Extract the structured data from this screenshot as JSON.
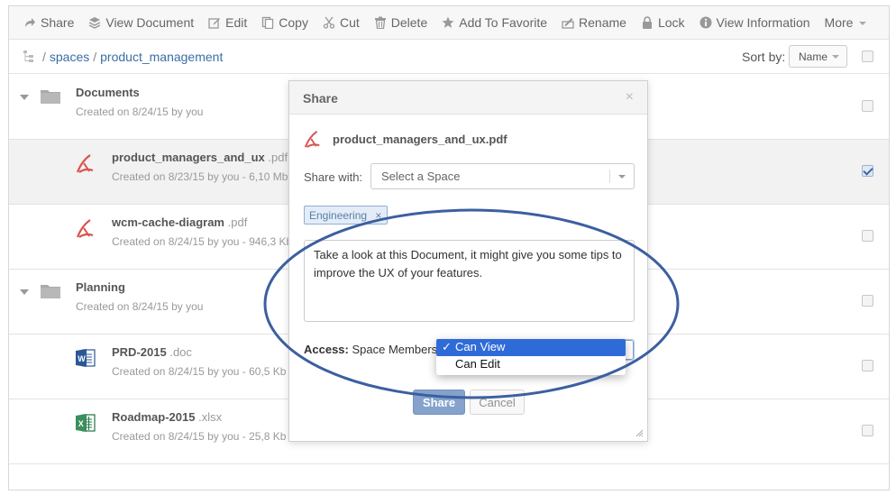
{
  "toolbar": {
    "items": [
      {
        "label": "Share",
        "icon": "share-icon"
      },
      {
        "label": "View Document",
        "icon": "layers-icon"
      },
      {
        "label": "Edit",
        "icon": "edit-icon"
      },
      {
        "label": "Copy",
        "icon": "copy-icon"
      },
      {
        "label": "Cut",
        "icon": "scissors-icon"
      },
      {
        "label": "Delete",
        "icon": "trash-icon"
      },
      {
        "label": "Add To Favorite",
        "icon": "star-icon"
      },
      {
        "label": "Rename",
        "icon": "rename-icon"
      },
      {
        "label": "Lock",
        "icon": "lock-icon"
      },
      {
        "label": "View Information",
        "icon": "info-icon"
      },
      {
        "label": "More",
        "icon": "chevron-down-icon"
      }
    ]
  },
  "breadcrumb": {
    "root_icon": "tree-icon",
    "sep": "/",
    "items": [
      "spaces",
      "product_management"
    ]
  },
  "sort": {
    "label": "Sort by:",
    "value": "Name"
  },
  "rows": [
    {
      "kind": "folder",
      "name": "Documents",
      "ext": "",
      "meta": "Created on 8/24/15 by you",
      "checked": false
    },
    {
      "kind": "pdf",
      "name": "product_managers_and_ux",
      "ext": ".pdf",
      "meta": "Created on 8/23/15 by you - 6,10 Mb",
      "checked": true
    },
    {
      "kind": "pdf",
      "name": "wcm-cache-diagram",
      "ext": ".pdf",
      "meta": "Created on 8/24/15 by you - 946,3 Kb",
      "checked": false
    },
    {
      "kind": "folder",
      "name": "Planning",
      "ext": "",
      "meta": "Created on 8/24/15 by you",
      "checked": false
    },
    {
      "kind": "word",
      "name": "PRD-2015",
      "ext": ".doc",
      "meta": "Created on 8/24/15 by you - 60,5 Kb",
      "checked": false
    },
    {
      "kind": "excel",
      "name": "Roadmap-2015",
      "ext": ".xlsx",
      "meta": "Created on 8/24/15 by you - 25,8 Kb",
      "checked": false
    }
  ],
  "dialog": {
    "title": "Share",
    "close": "×",
    "file_name": "product_managers_and_ux.pdf",
    "share_with_label": "Share with:",
    "space_select_placeholder": "Select a Space",
    "tag": "Engineering",
    "tag_remove": "×",
    "message": "Take a look at this Document, it might give you some tips to improve the UX of your features.",
    "access_label": "Access:",
    "access_target": "Space Members",
    "permission_options": [
      "Can View",
      "Can Edit"
    ],
    "permission_selected": "Can View",
    "share_button": "Share",
    "cancel_button": "Cancel"
  },
  "colors": {
    "accent": "#3a6ea5",
    "annotation": "#3c5fa0",
    "dropdown_highlight": "#2f6bd8"
  }
}
